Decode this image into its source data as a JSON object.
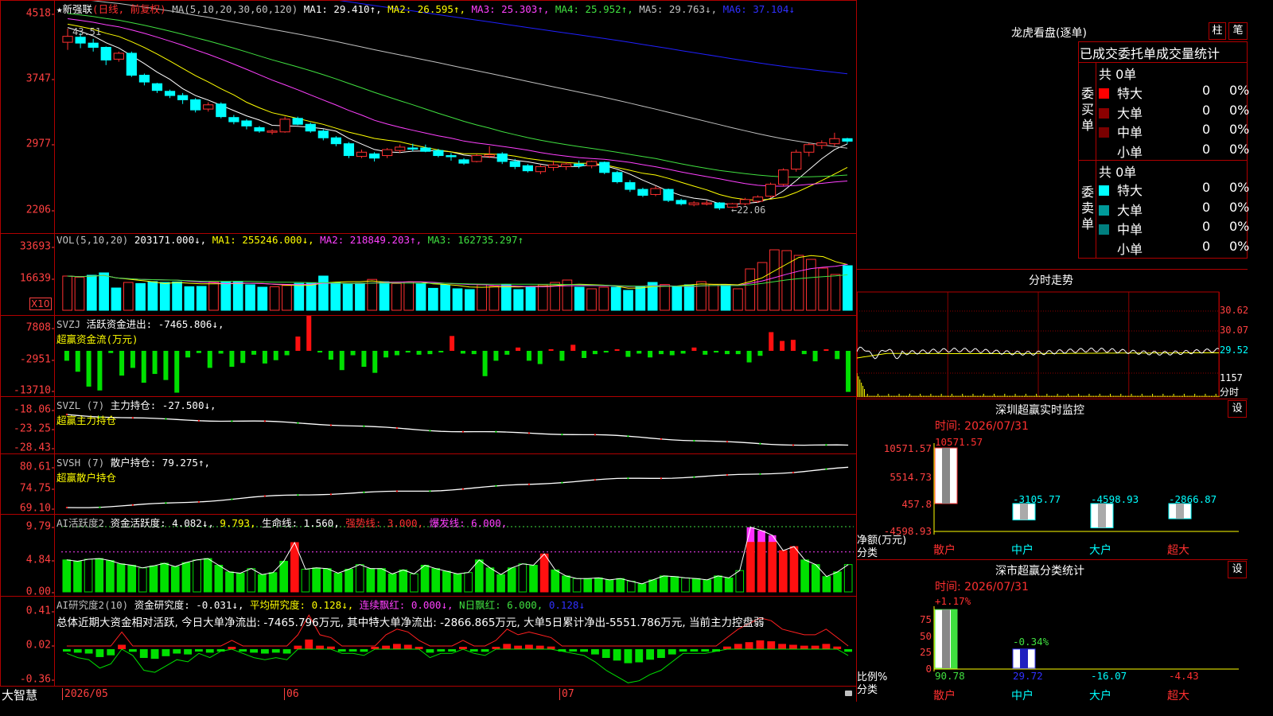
{
  "colors": {
    "up": "#ff3030",
    "down": "#00ffff",
    "ma1": "#ffffff",
    "ma2": "#ffff00",
    "ma3": "#ff40ff",
    "ma4": "#40e040",
    "ma5": "#c0c0c0",
    "ma6": "#2020ff",
    "axis": "#ff4040",
    "border": "#b00000",
    "green": "#00e000"
  },
  "main": {
    "yticks": [
      "4518",
      "3747",
      "2977",
      "2206"
    ],
    "star": "★",
    "name": "新强联",
    "mode": "(日线, 前复权)",
    "ma_label": "MA(5,10,20,30,60,120)",
    "ma1": "MA1: 29.410↑,",
    "ma2": "MA2: 26.595↑,",
    "ma3": "MA3: 25.303↑,",
    "ma4": "MA4: 25.952↑,",
    "ma5": "MA5: 29.763↓,",
    "ma6": "MA6: 37.104↓",
    "high_label": "43.51",
    "low_label": "←22.06",
    "candles": [
      [
        41.9,
        43.51,
        41.0,
        42.6
      ],
      [
        42.5,
        43.0,
        41.2,
        41.8
      ],
      [
        41.8,
        42.3,
        40.8,
        41.3
      ],
      [
        41.3,
        41.4,
        39.2,
        39.8
      ],
      [
        39.9,
        40.8,
        39.6,
        40.6
      ],
      [
        40.6,
        40.8,
        37.8,
        38.0
      ],
      [
        38.0,
        38.2,
        36.8,
        37.2
      ],
      [
        37.0,
        37.1,
        35.9,
        36.2
      ],
      [
        36.1,
        36.3,
        35.3,
        35.6
      ],
      [
        35.6,
        35.9,
        34.6,
        35.1
      ],
      [
        35.1,
        35.3,
        33.6,
        33.9
      ],
      [
        34.0,
        34.8,
        33.7,
        34.5
      ],
      [
        34.6,
        34.8,
        32.9,
        33.1
      ],
      [
        33.0,
        33.3,
        32.2,
        32.5
      ],
      [
        32.6,
        32.8,
        31.6,
        32.0
      ],
      [
        31.8,
        32.0,
        31.2,
        31.4
      ],
      [
        31.3,
        31.6,
        31.0,
        31.4
      ],
      [
        31.3,
        33.1,
        31.2,
        32.8
      ],
      [
        32.9,
        33.1,
        32.1,
        32.2
      ],
      [
        32.2,
        32.4,
        31.2,
        31.4
      ],
      [
        31.4,
        31.6,
        30.3,
        30.6
      ],
      [
        30.6,
        30.8,
        29.6,
        29.9
      ],
      [
        29.9,
        30.1,
        28.2,
        28.5
      ],
      [
        28.4,
        29.2,
        28.2,
        28.9
      ],
      [
        28.7,
        28.9,
        27.8,
        28.2
      ],
      [
        28.5,
        29.4,
        28.2,
        29.2
      ],
      [
        29.1,
        29.8,
        28.8,
        29.5
      ],
      [
        29.4,
        29.9,
        29.0,
        29.3
      ],
      [
        29.4,
        29.8,
        28.9,
        29.0
      ],
      [
        29.1,
        29.3,
        28.3,
        28.5
      ],
      [
        28.5,
        28.8,
        27.9,
        28.4
      ],
      [
        28.0,
        28.2,
        27.4,
        27.6
      ],
      [
        27.8,
        28.7,
        27.7,
        28.5
      ],
      [
        28.4,
        29.6,
        28.2,
        28.6
      ],
      [
        28.7,
        28.9,
        27.5,
        27.8
      ],
      [
        27.8,
        28.1,
        26.9,
        27.2
      ],
      [
        27.3,
        27.5,
        26.5,
        26.7
      ],
      [
        26.6,
        27.4,
        26.3,
        27.2
      ],
      [
        27.1,
        27.9,
        26.7,
        27.4
      ],
      [
        27.2,
        27.7,
        26.8,
        27.5
      ],
      [
        27.5,
        27.9,
        27.0,
        27.3
      ],
      [
        27.3,
        27.9,
        27.0,
        27.8
      ],
      [
        27.7,
        27.8,
        26.3,
        26.5
      ],
      [
        26.5,
        26.7,
        25.2,
        25.4
      ],
      [
        25.3,
        25.6,
        24.2,
        24.5
      ],
      [
        24.5,
        24.7,
        23.6,
        23.8
      ],
      [
        23.9,
        24.9,
        23.7,
        24.6
      ],
      [
        24.5,
        24.6,
        23.0,
        23.2
      ],
      [
        23.2,
        23.4,
        22.6,
        22.8
      ],
      [
        22.7,
        23.1,
        22.5,
        22.9
      ],
      [
        22.8,
        23.2,
        22.6,
        22.9
      ],
      [
        22.9,
        23.0,
        22.06,
        22.3
      ],
      [
        22.4,
        22.9,
        22.3,
        22.8
      ],
      [
        22.8,
        23.5,
        22.6,
        23.3
      ],
      [
        23.1,
        23.8,
        22.9,
        23.6
      ],
      [
        23.7,
        25.3,
        23.5,
        25.1
      ],
      [
        25.1,
        27.0,
        24.9,
        26.8
      ],
      [
        26.9,
        29.2,
        26.6,
        28.9
      ],
      [
        28.9,
        30.0,
        28.4,
        29.8
      ],
      [
        29.7,
        30.3,
        29.3,
        30.0
      ],
      [
        29.9,
        31.2,
        29.6,
        30.5
      ],
      [
        30.5,
        30.6,
        29.9,
        30.2
      ]
    ]
  },
  "vol": {
    "yticks": [
      "33693",
      "16639"
    ],
    "unit": "X10",
    "label": "VOL(5,10,20)",
    "v": "203171.000↓,",
    "ma1": "MA1: 255246.000↓,",
    "ma2": "MA2: 218849.203↑,",
    "ma3": "MA3: 162735.297↑",
    "values": [
      21.5,
      20.8,
      22.0,
      23.5,
      14.0,
      17.5,
      16.8,
      18.0,
      17.5,
      17.8,
      14.8,
      15.0,
      17.9,
      18.0,
      18.2,
      16.0,
      14.5,
      14.8,
      15.6,
      16.9,
      17.0,
      21.5,
      17.5,
      16.8,
      17.0,
      19.4,
      17.9,
      16.8,
      17.8,
      16.9,
      13.8,
      16.0,
      13.5,
      13.0,
      16.0,
      15.0,
      16.2,
      13.0,
      15.0,
      16.0,
      17.5,
      19.0,
      14.5,
      13.5,
      14.5,
      14.5,
      12.5,
      15.0,
      17.5,
      16.2,
      15.0,
      16.0,
      18.0,
      16.2,
      16.2,
      13.5,
      26.0,
      30.0,
      38.0,
      37.5,
      34.5,
      32.0,
      26.5,
      22.5,
      28.0
    ]
  },
  "svzj": {
    "yticks": [
      "7808",
      "-2951",
      "-13710"
    ],
    "label": "SVZJ",
    "text": "活跃资金进出: -7465.806↓,",
    "sub": "超赢资金流(万元)",
    "values": [
      -1800,
      -3800,
      -6500,
      -7200,
      -400,
      -4500,
      -3100,
      -5800,
      -4200,
      -5300,
      -7600,
      -1200,
      -400,
      -3100,
      -500,
      -2900,
      -2200,
      -700,
      -2300,
      -1700,
      -800,
      2600,
      6700,
      -300,
      -1600,
      -3500,
      -800,
      -2900,
      -4000,
      -1200,
      -800,
      -300,
      -700,
      -600,
      -200,
      2700,
      -500,
      -600,
      -4600,
      -1800,
      -700,
      600,
      -1800,
      -2400,
      300,
      -1800,
      1100,
      -1300,
      -600,
      -300,
      200,
      -1100,
      -500,
      -1200,
      -600,
      -800,
      -500,
      600,
      -700,
      -300,
      -600,
      -600,
      -2100,
      -900,
      3400,
      1800,
      2000,
      -600,
      -1900,
      200,
      -1500,
      -7465
    ]
  },
  "svzl": {
    "yticks": [
      "-18.06",
      "-23.25",
      "-28.43"
    ],
    "label": "SVZL",
    "param": "(7)",
    "text": "主力持仓: -27.500↓,",
    "sub": "超赢主力持仓"
  },
  "svsh": {
    "yticks": [
      "80.61",
      "74.75",
      "69.10"
    ],
    "label": "SVSH",
    "param": "(7)",
    "text": "散户持仓: 79.275↑,",
    "sub": "超赢散户持仓"
  },
  "ai": {
    "yticks": [
      "9.79",
      "4.84",
      "0.00"
    ],
    "label": "AI活跃度2",
    "t1": "资金活跃度: 4.082↓,",
    "t2": "9.793,",
    "t3": "生命线: 1.560,",
    "t4": "强势线: 3.000,",
    "t5": "爆发线: 6.000,",
    "values": [
      4.8,
      4.6,
      4.9,
      5.0,
      4.7,
      4.2,
      4.0,
      3.6,
      3.9,
      4.3,
      3.8,
      4.4,
      4.8,
      5.0,
      4.0,
      3.0,
      2.8,
      3.5,
      2.6,
      2.9,
      4.6,
      7.4,
      3.4,
      3.6,
      3.5,
      2.8,
      3.4,
      4.1,
      3.5,
      3.5,
      2.7,
      3.3,
      2.7,
      4.0,
      3.5,
      3.1,
      2.7,
      2.9,
      4.8,
      3.6,
      2.6,
      3.6,
      4.2,
      4.0,
      5.7,
      3.3,
      2.4,
      2.0,
      2.0,
      2.1,
      1.8,
      2.0,
      1.6,
      1.2,
      1.8,
      2.4,
      2.3,
      2.1,
      2.0,
      1.8,
      2.4,
      2.1,
      3.2,
      9.7,
      9.2,
      8.5,
      6.2,
      6.8,
      4.8,
      4.1,
      2.3,
      3.0,
      4.1
    ]
  },
  "yjd": {
    "yticks": [
      "0.41",
      "0.02",
      "-0.36"
    ],
    "label": "AI研究度2(10)",
    "t1": "资金研究度: -0.031↓,",
    "t2": "平均研究度: 0.128↓,",
    "t3": "连续飘红: 0.000↓,",
    "t4": "N日飘红: 6.000,",
    "t5": "0.128↓",
    "summary": "总体近期大资金相对活跃, 今日大单净流出: -7465.796万元, 其中特大单净流出: -2866.865万元, 大单5日累计净出-5551.786万元, 当前主力控盘弱",
    "values": [
      -0.02,
      -0.04,
      -0.05,
      -0.09,
      -0.07,
      0.05,
      -0.03,
      -0.1,
      -0.11,
      -0.08,
      -0.05,
      -0.06,
      -0.02,
      -0.04,
      -0.01,
      0.02,
      -0.02,
      -0.04,
      -0.05,
      -0.04,
      -0.05,
      0.04,
      0.11,
      0.04,
      0.03,
      -0.02,
      -0.02,
      -0.03,
      0.0,
      0.04,
      0.06,
      0.05,
      0.02,
      -0.04,
      -0.02,
      -0.02,
      0.02,
      -0.02,
      -0.03,
      0.02,
      0.06,
      0.04,
      0.05,
      0.04,
      0.03,
      -0.01,
      -0.02,
      -0.03,
      -0.06,
      -0.1,
      -0.13,
      -0.16,
      -0.15,
      -0.12,
      -0.1,
      -0.06,
      -0.02,
      -0.02,
      -0.02,
      -0.01,
      0.03,
      0.06,
      0.08,
      0.1,
      0.09,
      0.06,
      0.05,
      0.04,
      0.04,
      0.06,
      0.03,
      -0.03
    ]
  },
  "xaxis": {
    "brand": "大智慧",
    "d1": "2026/05",
    "d2": "06",
    "d3": "07"
  },
  "right": {
    "lh_title": "龙虎看盘(逐单)",
    "btn_bar": "柱",
    "btn_pen": "笔",
    "stat_title": "已成交委托单成交量统计",
    "buy_total": "共 0单",
    "buy_label": "委买单",
    "sell_total": "共 0单",
    "sell_label": "委卖单",
    "buy_rows": [
      {
        "name": "特大",
        "n": "0",
        "p": "0%",
        "c": "#ff0000"
      },
      {
        "name": "大单",
        "n": "0",
        "p": "0%",
        "c": "#8b0000"
      },
      {
        "name": "中单",
        "n": "0",
        "p": "0%",
        "c": "#7a0000"
      },
      {
        "name": "小单",
        "n": "0",
        "p": "0%",
        "c": "#000000"
      }
    ],
    "sell_rows": [
      {
        "name": "特大",
        "n": "0",
        "p": "0%",
        "c": "#00ffff"
      },
      {
        "name": "大单",
        "n": "0",
        "p": "0%",
        "c": "#009a9a"
      },
      {
        "name": "中单",
        "n": "0",
        "p": "0%",
        "c": "#007f7f"
      },
      {
        "name": "小单",
        "n": "0",
        "p": "0%",
        "c": "#000000"
      }
    ],
    "fs_title": "分时走势",
    "fs_ticks": [
      "30.62",
      "30.07",
      "29.52",
      "1157",
      "分时"
    ],
    "sz_title": "深圳超赢实时监控",
    "sz_set": "设",
    "sz_time": "时间: 2026/07/31",
    "sz_yticks": [
      "10571.57",
      "5514.73",
      "457.8",
      "-4598.93"
    ],
    "sz_vals": [
      "10571.57",
      "-3105.77",
      "-4598.93",
      "-2866.87"
    ],
    "sz_ylab1": "净额(万元)",
    "sz_ylab2": "分类",
    "cats": [
      "散户",
      "中户",
      "大户",
      "超大"
    ],
    "sc_title": "深市超赢分类统计",
    "sc_set": "设",
    "sc_time": "时间: 2026/07/31",
    "sc_top1": "+1.17%",
    "sc_top2": "-0.34%",
    "sc_yticks": [
      "75",
      "50",
      "25",
      "0"
    ],
    "sc_vals": [
      "90.78",
      "29.72",
      "-16.07",
      "-4.43"
    ],
    "sc_ylab1": "比例%",
    "sc_ylab2": "分类"
  }
}
